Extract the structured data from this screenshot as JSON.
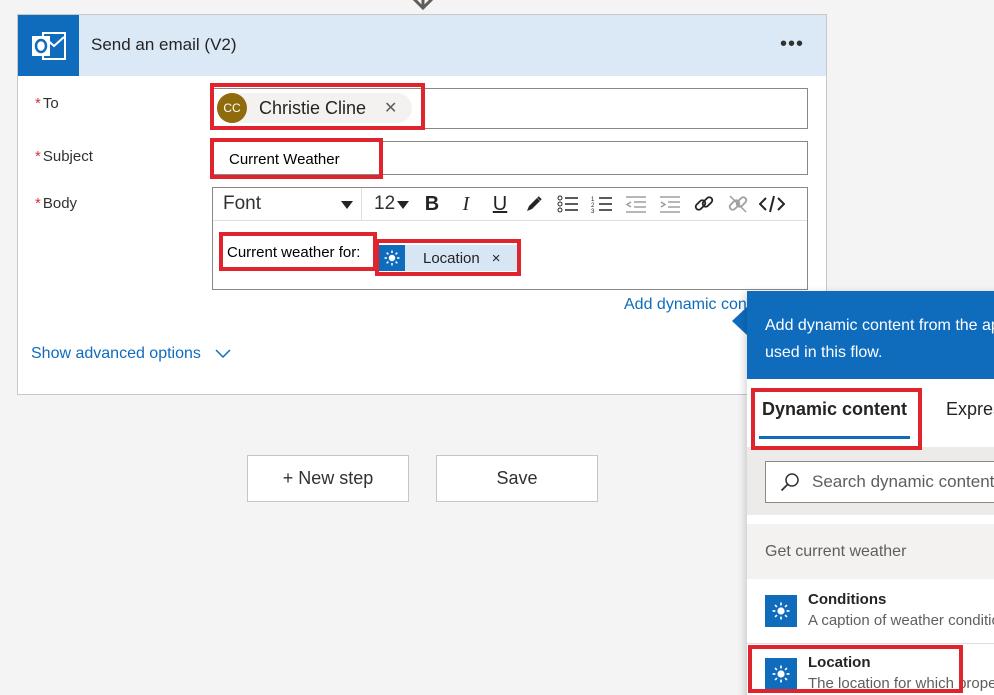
{
  "action": {
    "title": "Send an email (V2)",
    "more_label": "•••"
  },
  "fields": {
    "to_label": "To",
    "subject_label": "Subject",
    "body_label": "Body",
    "required_mark": "*"
  },
  "to": {
    "recipient_initials": "CC",
    "recipient_name": "Christie Cline",
    "remove_glyph": "✕"
  },
  "subject": {
    "value": "Current Weather"
  },
  "toolbar": {
    "font_value": "Font",
    "size_value": "12",
    "bold": "B",
    "italic": "I",
    "underline": "U"
  },
  "body": {
    "text": "Current weather for:",
    "token_label": "Location",
    "token_remove": "×"
  },
  "links": {
    "add_dynamic": "Add dynamic content",
    "show_advanced": "Show advanced options"
  },
  "buttons": {
    "new_step": "+ New step",
    "save": "Save"
  },
  "dynamic_panel": {
    "description_line1": "Add dynamic content from the apps and connectors",
    "description_line2": "used in this flow.",
    "tabs": [
      {
        "label": "Dynamic content",
        "selected": true
      },
      {
        "label": "Expression",
        "selected": false
      }
    ],
    "search_placeholder": "Search dynamic content",
    "group_title": "Get current weather",
    "items": [
      {
        "name": "Conditions",
        "description": "A caption of weather conditions"
      },
      {
        "name": "Location",
        "description": "The location for which properties are reported"
      }
    ]
  },
  "colors": {
    "accent": "#0f6cbd",
    "header_bg": "#dbe9f7",
    "highlight": "#e0242e",
    "avatar": "#8f6b0d"
  }
}
